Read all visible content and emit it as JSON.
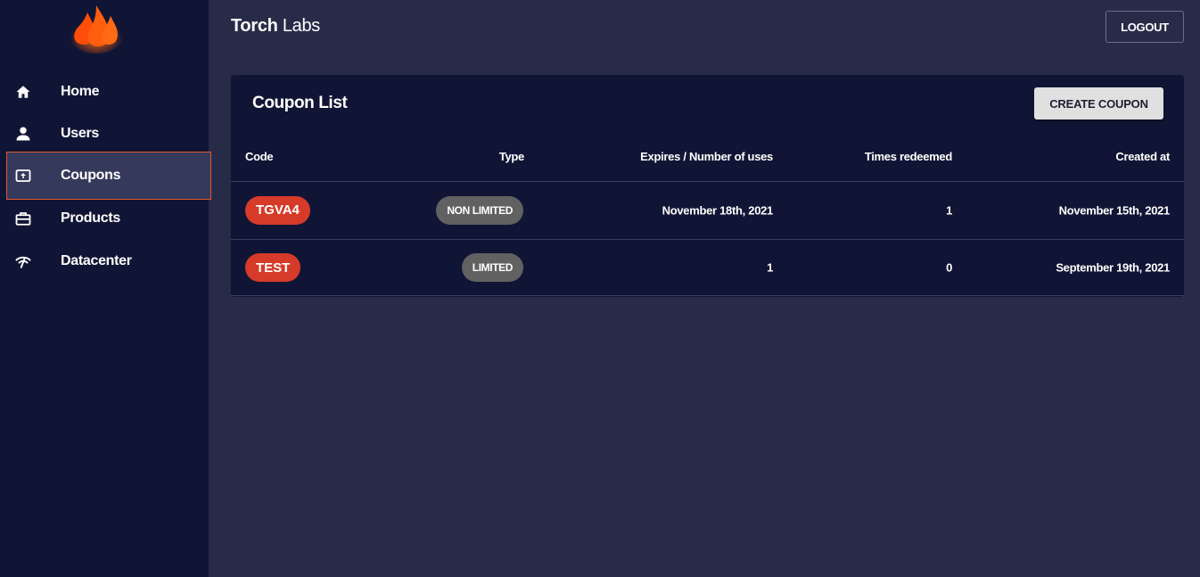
{
  "brand": {
    "bold": "Torch",
    "rest": " Labs"
  },
  "header": {
    "logout_label": "LOGOUT"
  },
  "sidebar": {
    "items": [
      {
        "label": "Home",
        "icon": "home-icon"
      },
      {
        "label": "Users",
        "icon": "user-icon"
      },
      {
        "label": "Coupons",
        "icon": "coupon-icon",
        "active": true
      },
      {
        "label": "Products",
        "icon": "briefcase-icon"
      },
      {
        "label": "Datacenter",
        "icon": "wifi-icon"
      }
    ]
  },
  "card": {
    "title": "Coupon List",
    "create_label": "CREATE COUPON",
    "columns": [
      "Code",
      "Type",
      "Expires / Number of uses",
      "Times redeemed",
      "Created at"
    ],
    "rows": [
      {
        "code": "TGVA4",
        "type": "NON LIMITED",
        "expires": "November 18th, 2021",
        "redeemed": "1",
        "created": "November 15th, 2021"
      },
      {
        "code": "TEST",
        "type": "LIMITED",
        "expires": "1",
        "redeemed": "0",
        "created": "September 19th, 2021"
      }
    ]
  },
  "colors": {
    "sidebar_bg": "#111535",
    "main_bg": "#282b48",
    "card_bg": "#111535",
    "active_border": "#e0582a",
    "code_chip": "#d63b2a",
    "type_chip": "#616161",
    "logo_flame": "#f05a1a"
  }
}
